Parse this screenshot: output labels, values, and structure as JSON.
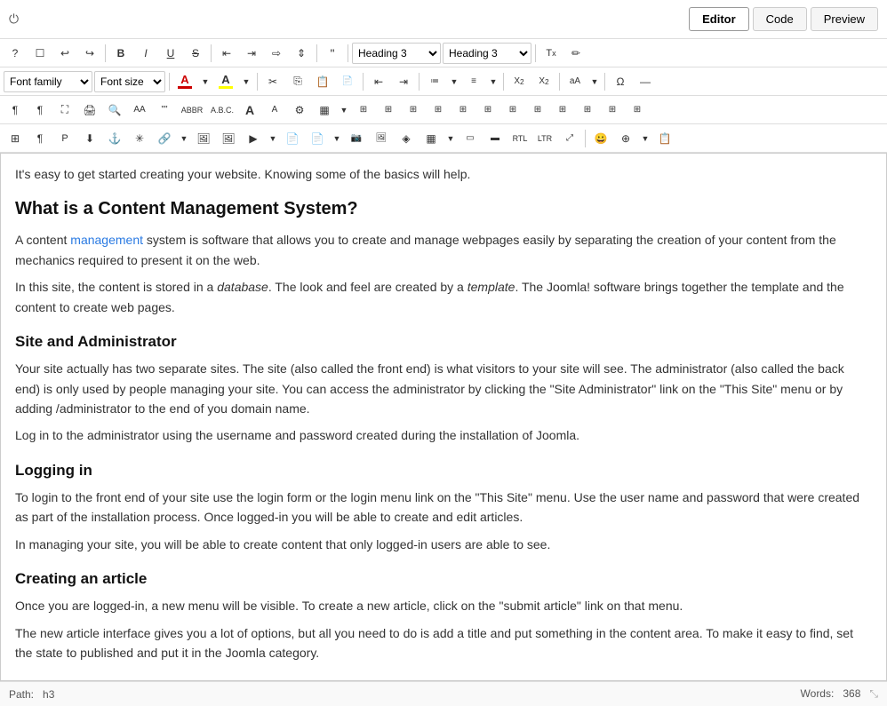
{
  "topbar": {
    "editor_label": "Editor",
    "code_label": "Code",
    "preview_label": "Preview"
  },
  "toolbar1": {
    "help_icon": "?",
    "new_icon": "☐",
    "undo_icon": "↩",
    "redo_icon": "↪",
    "bold_icon": "B",
    "italic_icon": "I",
    "underline_icon": "U",
    "strikethrough_icon": "S",
    "align_left_icon": "≡",
    "align_center_icon": "≡",
    "align_right_icon": "≡",
    "align_justify_icon": "≡",
    "blockquote_icon": "❝",
    "heading3_value": "Heading 3",
    "heading3b_value": "Heading 3",
    "clear_formatting_icon": "Tx",
    "source_icon": "🖉"
  },
  "toolbar2": {
    "font_family_label": "Font family",
    "font_size_label": "Font size"
  },
  "content": {
    "intro": "It's easy to get started creating your website. Knowing some of the basics will help.",
    "h2_1": "What is a Content Management System?",
    "p1": "A content management system is software that allows you to create and manage webpages easily by separating the creation of your content from the mechanics required to present it on the web.",
    "p2_pre": "In this site, the content is stored in a ",
    "p2_db": "database",
    "p2_mid": ". The look and feel are created by a ",
    "p2_tmpl": "template",
    "p2_post": ". The Joomla! software brings together the template and the content to create web pages.",
    "h3_1": "Site and Administrator",
    "p3": "Your site actually has two separate sites. The site (also called the front end) is what visitors to your site will see. The administrator (also called the back end) is only used by people managing your site. You can access the administrator by clicking the \"Site Administrator\" link on the \"This Site\" menu or by adding /administrator to the end of you domain name.",
    "p4": "Log in to the administrator using the username and password created during the installation of Joomla.",
    "h3_2": "Logging in",
    "p5": "To login to the front end of your site use the login form or the login menu link on the \"This Site\" menu. Use the user name and password that were created as part of the installation process. Once logged-in you will be able to create and edit articles.",
    "p6": "In managing your site, you will be able to create content that only logged-in users are able to see.",
    "h3_3": "Creating an article",
    "p7": "Once you are logged-in, a new menu will be visible. To create a new article, click on the \"submit article\" link on that menu.",
    "p8": "The new article interface gives you a lot of options, but all you need to do is add a title and put something in the content area. To make it easy to find, set the state to published and put it in the Joomla category.",
    "management_link": "management"
  },
  "statusbar": {
    "path": "Path:",
    "path_value": "h3",
    "words_label": "Words:",
    "words_count": "368"
  }
}
